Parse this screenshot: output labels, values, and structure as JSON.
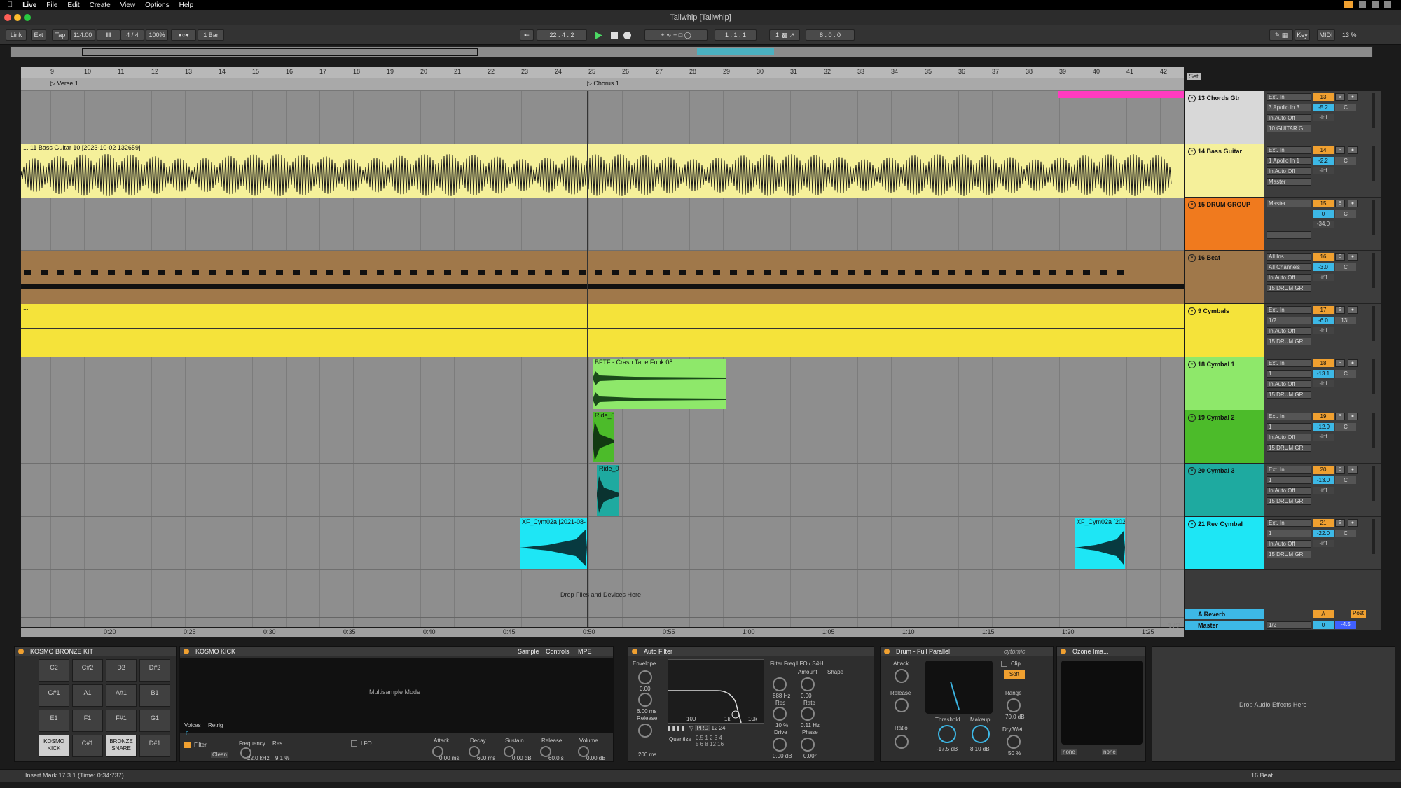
{
  "menubar": {
    "app": "Live",
    "items": [
      "File",
      "Edit",
      "Create",
      "View",
      "Options",
      "Help"
    ]
  },
  "window_title": "Tailwhip  [Tailwhip]",
  "control_bar": {
    "link": "Link",
    "ext": "Ext",
    "tap": "Tap",
    "tempo": "114.00",
    "signature": "4 / 4",
    "zoom": "100%",
    "quant": "1 Bar",
    "position": "22 .  4 .  2",
    "loop_start": "1 .  1 .  1",
    "loop_length": "8 .  0 .  0",
    "key": "Key",
    "midi": "MIDI",
    "cpu": "13 %"
  },
  "ruler_numbers": [
    "9",
    "10",
    "11",
    "12",
    "13",
    "14",
    "15",
    "16",
    "17",
    "18",
    "19",
    "20",
    "21",
    "22",
    "23",
    "24",
    "25",
    "26",
    "27",
    "28",
    "29",
    "30",
    "31",
    "32",
    "33",
    "34",
    "35",
    "36",
    "37",
    "38",
    "39",
    "40",
    "41",
    "42"
  ],
  "locators": {
    "verse": "Verse 1",
    "chorus": "Chorus 1",
    "set": "Set"
  },
  "clips": {
    "bass": "... 11 Bass Guitar 10 [2023-10-02 132659]",
    "crash": "BFTF - Crash Tape Funk 08",
    "ride1": "Ride_0",
    "ride2": "Ride_0",
    "cym1": "XF_Cym02a [2021-08-",
    "cym2": "XF_Cym02a [202",
    "beat_dots": "...",
    "cymbals_dots": "..."
  },
  "drop_files": "Drop Files and Devices Here",
  "tracks": [
    {
      "name": "13 Chords Gtr",
      "color": "#d8d8d8",
      "io": [
        "Ext. In",
        "3 Apollo In 3",
        "In  Auto  Off",
        "10 GUITAR G"
      ],
      "num": "13",
      "vol": "-5.2",
      "pan": "C",
      "mins": "-inf"
    },
    {
      "name": "14 Bass Guitar",
      "color": "#f5f09a",
      "io": [
        "Ext. In",
        "1 Apollo In 1",
        "In  Auto  Off",
        "Master"
      ],
      "num": "14",
      "vol": "-2.2",
      "pan": "C",
      "mins": "-inf"
    },
    {
      "name": "15 DRUM GROUP",
      "color": "#f07a1e",
      "io": [
        "Master",
        "",
        "",
        " "
      ],
      "num": "15",
      "vol": "0",
      "pan": "C",
      "mins": "-34.0"
    },
    {
      "name": "16 Beat",
      "color": "#a0784a",
      "io": [
        "All Ins",
        "All Channels",
        "In  Auto  Off",
        "15 DRUM GR"
      ],
      "num": "16",
      "vol": "-3.0",
      "pan": "C",
      "mins": "-inf"
    },
    {
      "name": "9 Cymbals",
      "color": "#f5e33a",
      "io": [
        "Ext. In",
        "1/2",
        "In  Auto  Off",
        "15 DRUM GR"
      ],
      "num": "17",
      "vol": "-6.0",
      "pan": "13L",
      "mins": "-inf"
    },
    {
      "name": "18 Cymbal 1",
      "color": "#8ee86a",
      "io": [
        "Ext. In",
        "1",
        "In  Auto  Off",
        "15 DRUM GR"
      ],
      "num": "18",
      "vol": "-13.1",
      "pan": "C",
      "mins": "-inf"
    },
    {
      "name": "19 Cymbal 2",
      "color": "#4cbb2a",
      "io": [
        "Ext. In",
        "1",
        "In  Auto  Off",
        "15 DRUM GR"
      ],
      "num": "19",
      "vol": "-12.9",
      "pan": "C",
      "mins": "-inf"
    },
    {
      "name": "20 Cymbal 3",
      "color": "#1eaaa0",
      "io": [
        "Ext. In",
        "1",
        "In  Auto  Off",
        "15 DRUM GR"
      ],
      "num": "20",
      "vol": "-13.0",
      "pan": "C",
      "mins": "-inf"
    },
    {
      "name": "21 Rev Cymbal",
      "color": "#1ee6f5",
      "io": [
        "Ext. In",
        "1",
        "In  Auto  Off",
        "15 DRUM GR"
      ],
      "num": "21",
      "vol": "-22.0",
      "pan": "C",
      "mins": "-inf"
    }
  ],
  "returns": [
    {
      "name": "A Reverb",
      "num": "A",
      "extra": "Post"
    },
    {
      "name": "Master",
      "num": "0",
      "io": "1/2",
      "vol": "-4.5"
    }
  ],
  "page_indicator": "1/2",
  "time_labels": [
    "0:20",
    "0:25",
    "0:30",
    "0:35",
    "0:40",
    "0:45",
    "0:50",
    "0:55",
    "1:00",
    "1:05",
    "1:10",
    "1:15",
    "1:20",
    "1:25"
  ],
  "devices": {
    "drum_rack": {
      "title": "KOSMO BRONZE KIT",
      "pads": [
        "C2",
        "C#2",
        "D2",
        "D#2",
        "G#1",
        "A1",
        "A#1",
        "B1",
        "E1",
        "F1",
        "F#1",
        "G1",
        "KOSMO KICK",
        "C#1",
        "BRONZE SNARE",
        "D#1"
      ]
    },
    "kick": {
      "title": "KOSMO KICK",
      "tabs": [
        "Sample",
        "Controls",
        "MPE"
      ],
      "mode": "Multisample Mode",
      "voices_label": "Voices",
      "voices": "6",
      "retrig": "Retrig",
      "filter": "Filter",
      "clean": "Clean",
      "freq_label": "Frequency",
      "freq": "22.0 kHz",
      "res_label": "Res",
      "res": "9.1 %",
      "attack": "Attack",
      "attack_v": "0.00 ms",
      "decay": "Decay",
      "decay_v": "600 ms",
      "sustain": "Sustain",
      "sustain_v": "0.00 dB",
      "release": "Release",
      "release_v": "60.0 s",
      "volume": "Volume",
      "volume_v": "0.00 dB",
      "lfo": "LFO"
    },
    "autofilter": {
      "title": "Auto Filter",
      "envelope": "Envelope",
      "env_v": "0.00",
      "attack_v": "6.00 ms",
      "release": "Release",
      "release_v": "200 ms",
      "freq": "Filter Freq",
      "freq_v": "888 Hz",
      "res": "Res",
      "res_v": "10 %",
      "drive": "Drive",
      "drive_v": "0.00 dB",
      "lfo": "LFO / S&H",
      "amount": "Amount",
      "amount_v": "0.00",
      "rate": "Rate",
      "rate_v": "0.11 Hz",
      "phase": "Phase",
      "phase_v": "0.00°",
      "shape": "Shape",
      "quantize": "Quantize",
      "mode": "PRD",
      "axis": [
        "100",
        "1k",
        "10k"
      ]
    },
    "drumbus": {
      "title": "Drum - Full Parallel",
      "brand": "cytomic",
      "attack": "Attack",
      "release": "Release",
      "ratio": "Ratio",
      "threshold": "Threshold",
      "thr_v": "-17.5 dB",
      "makeup": "Makeup",
      "mk_v": "8.10 dB",
      "clip": "Clip",
      "soft": "Soft",
      "range": "Range",
      "range_v": "70.0 dB",
      "drywet": "Dry/Wet",
      "dw_v": "50 %"
    },
    "ozone": {
      "title": "Ozone Ima...",
      "none1": "none",
      "none2": "none"
    },
    "drop_fx": "Drop Audio Effects Here"
  },
  "status": {
    "text": "Insert Mark 17.3.1 (Time: 0:34:737)",
    "track": "16 Beat"
  }
}
